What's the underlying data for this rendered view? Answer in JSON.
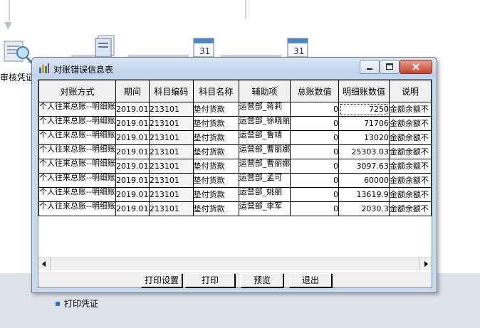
{
  "background": {
    "audit_voucher_label": "审核凭证",
    "print_voucher_label": "打印凭证"
  },
  "dialog": {
    "title": "对账错误信息表",
    "columns": [
      "对账方式",
      "期间",
      "科目编码",
      "科目名称",
      "辅助项",
      "总账数值",
      "明细账数值",
      "说明"
    ],
    "rows": [
      {
        "method": "个人往来总账--明细账",
        "period": "2019.01",
        "code": "213101",
        "name": "垫付货款",
        "aux": "运营部_蒋莉",
        "ledger": "0",
        "detail": "7250",
        "note": "金额余额不"
      },
      {
        "method": "个人往来总账--明细账",
        "period": "2019.01",
        "code": "213101",
        "name": "垫付货款",
        "aux": "运营部_徐晓丽",
        "ledger": "0",
        "detail": "71706",
        "note": "金额余额不"
      },
      {
        "method": "个人往来总账--明细账",
        "period": "2019.01",
        "code": "213101",
        "name": "垫付货款",
        "aux": "运营部_鲁靖",
        "ledger": "0",
        "detail": "13020",
        "note": "金额余额不"
      },
      {
        "method": "个人往来总账--明细账",
        "period": "2019.01",
        "code": "213101",
        "name": "垫付货款",
        "aux": "运营部_曹丽娜",
        "ledger": "0",
        "detail": "25303.03",
        "note": "金额余额不"
      },
      {
        "method": "个人往来总账--明细账",
        "period": "2019.01",
        "code": "213101",
        "name": "垫付货款",
        "aux": "运营部_曹丽娜",
        "ledger": "0",
        "detail": "3097.63",
        "note": "金额余额不"
      },
      {
        "method": "个人往来总账--明细账",
        "period": "2019.01",
        "code": "213101",
        "name": "垫付货款",
        "aux": "运营部_孟可",
        "ledger": "0",
        "detail": "60000",
        "note": "金额余额不"
      },
      {
        "method": "个人往来总账--明细账",
        "period": "2019.01",
        "code": "213101",
        "name": "垫付货款",
        "aux": "运营部_姚丽",
        "ledger": "0",
        "detail": "13619.9",
        "note": "金额余额不"
      },
      {
        "method": "个人往来总账--明细账",
        "period": "2019.01",
        "code": "213101",
        "name": "垫付货款",
        "aux": "运营部_李军",
        "ledger": "0",
        "detail": "2030.3",
        "note": "金额余额不"
      }
    ],
    "buttons": {
      "print_setup": "打印设置",
      "print": "打印",
      "preview": "预览",
      "exit": "退出"
    }
  },
  "colors": {
    "titlebar": "#c9d9ec",
    "close_button": "#c4432b",
    "grid_line": "#000000"
  }
}
